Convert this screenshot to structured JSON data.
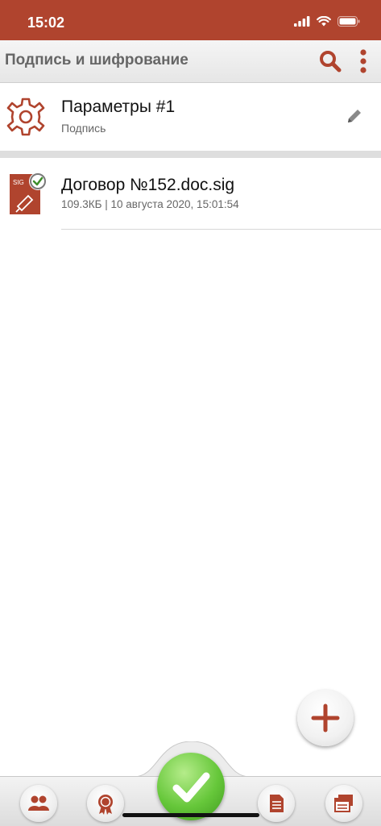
{
  "status_bar": {
    "time": "15:02"
  },
  "header": {
    "title": "Подпись и шифрование"
  },
  "parameters": {
    "title": "Параметры #1",
    "subtitle": "Подпись"
  },
  "files": [
    {
      "name": "Договор №152.doc.sig",
      "meta": "109.3КБ | 10 августа 2020, 15:01:54",
      "badge": "SIG"
    }
  ],
  "colors": {
    "accent": "#b0442e",
    "confirm": "#5cbf33"
  }
}
